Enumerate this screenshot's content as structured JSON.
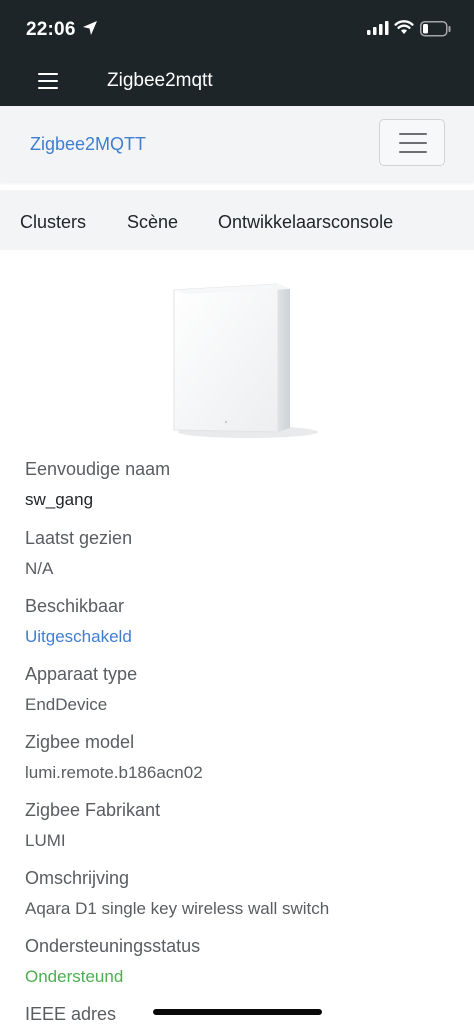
{
  "status_bar": {
    "time": "22:06",
    "location_icon": "location-arrow-icon",
    "signal_icon": "cellular-signal-icon",
    "wifi_icon": "wifi-icon",
    "battery_icon": "battery-low-icon"
  },
  "app_bar": {
    "menu_icon": "hamburger-menu-icon",
    "title": "Zigbee2mqtt"
  },
  "navbar": {
    "brand": "Zigbee2MQTT",
    "toggler_icon": "hamburger-menu-icon"
  },
  "tabs": [
    {
      "label": "Clusters"
    },
    {
      "label": "Scène"
    },
    {
      "label": "Ontwikkelaarsconsole"
    }
  ],
  "device_image": "wall-switch-device-image",
  "details": [
    {
      "label": "Eenvoudige naam",
      "value": "sw_gang"
    },
    {
      "label": "Laatst gezien",
      "value": "N/A"
    },
    {
      "label": "Beschikbaar",
      "value": "Uitgeschakeld"
    },
    {
      "label": "Apparaat type",
      "value": "EndDevice"
    },
    {
      "label": "Zigbee model",
      "value": "lumi.remote.b186acn02"
    },
    {
      "label": "Zigbee Fabrikant",
      "value": "LUMI"
    },
    {
      "label": "Omschrijving",
      "value": "Aqara D1 single key wireless wall switch"
    },
    {
      "label": "Ondersteuningsstatus",
      "value": "Ondersteund"
    },
    {
      "label": "IEEE adres",
      "value": ""
    }
  ],
  "colors": {
    "top_bar": "#1d2528",
    "navbar": "#f3f4f6",
    "link": "#3f7ed1",
    "success": "#4caf50",
    "label_text": "#595d62"
  }
}
